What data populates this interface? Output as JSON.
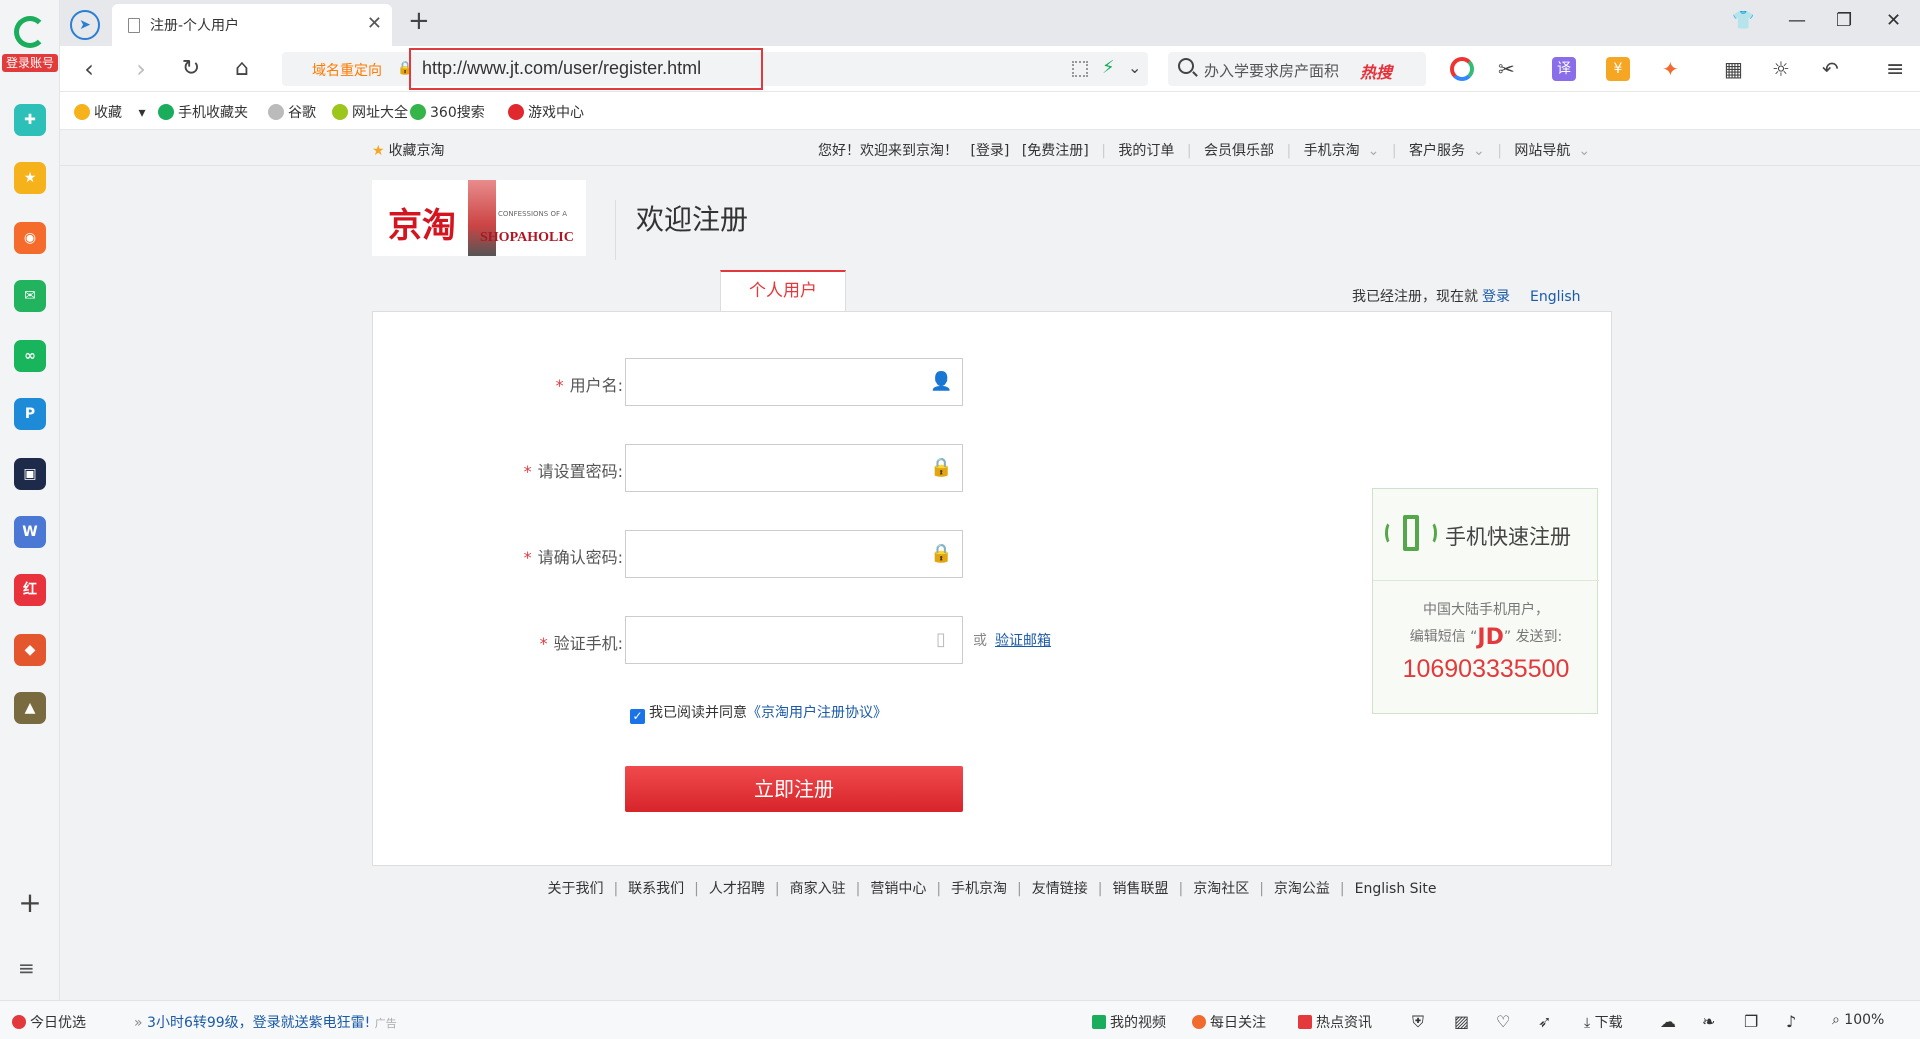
{
  "sidebar": {
    "login_label": "登录账号",
    "apps": [
      {
        "icon": "health-app-icon",
        "color": "#2cc0b8",
        "glyph": "✚"
      },
      {
        "icon": "star-bookmark-app-icon",
        "color": "#f5b21b",
        "glyph": "★"
      },
      {
        "icon": "weibo-app-icon",
        "color": "#f46b2b",
        "glyph": "◉"
      },
      {
        "icon": "mail-app-icon",
        "color": "#22b35e",
        "glyph": "✉"
      },
      {
        "icon": "cloud-app-icon",
        "color": "#19b55c",
        "glyph": "∞"
      },
      {
        "icon": "p-app-icon",
        "color": "#1e8bd9",
        "glyph": "P"
      },
      {
        "icon": "news-app-icon",
        "color": "#1d2a4a",
        "glyph": "▣"
      },
      {
        "icon": "word-doc-app-icon",
        "color": "#4a78d4",
        "glyph": "W"
      },
      {
        "icon": "xiaohongshu-app-icon",
        "color": "#e8323c",
        "glyph": "红"
      },
      {
        "icon": "game-app-icon",
        "color": "#e4572e",
        "glyph": "◆"
      },
      {
        "icon": "pubg-app-icon",
        "color": "#7a6a40",
        "glyph": "▲"
      }
    ]
  },
  "tab": {
    "title": "注册-个人用户"
  },
  "toolbar": {
    "redirect_label": "域名重定向",
    "url": "http://www.jt.com/user/register.html",
    "search_query": "办入学要求房产面积",
    "hot_label": "热搜"
  },
  "bookmarks": [
    {
      "label": "收藏",
      "icon": "star-icon",
      "color": "#f5b21b"
    },
    {
      "label": "手机收藏夹",
      "icon": "phone-icon",
      "color": "#1aad5c"
    },
    {
      "label": "谷歌",
      "icon": "doc-icon",
      "color": "#bbbbbb"
    },
    {
      "label": "网址大全",
      "icon": "nav-icon",
      "color": "#9dc61c"
    },
    {
      "label": "360搜索",
      "icon": "360-icon",
      "color": "#35b44a"
    },
    {
      "label": "游戏中心",
      "icon": "game-center-icon",
      "color": "#e1282f"
    }
  ],
  "topnav": {
    "favorite": "收藏京淘",
    "greeting": "您好！欢迎来到京淘！",
    "login": "[登录]",
    "register": "[免费注册]",
    "items": [
      "我的订单",
      "会员俱乐部",
      "手机京淘",
      "客户服务",
      "网站导航"
    ]
  },
  "header": {
    "logo_text": "京淘",
    "book_title": "SHOPAHOLIC",
    "book_sub": "CONFESSIONS OF A",
    "welcome": "欢迎注册"
  },
  "tabs": {
    "personal": "个人用户",
    "already": "我已经注册，现在就",
    "login": "登录",
    "english": "English"
  },
  "form": {
    "fields": [
      {
        "label": "用户名:",
        "icon": "user-icon"
      },
      {
        "label": "请设置密码:",
        "icon": "lock-icon"
      },
      {
        "label": "请确认密码:",
        "icon": "lock-icon"
      },
      {
        "label": "验证手机:",
        "icon": "phone-icon"
      }
    ],
    "or": "或",
    "verify_email": "验证邮箱",
    "agree_text": "我已阅读并同意",
    "agreement": "《京淘用户注册协议》",
    "submit": "立即注册"
  },
  "mobile_reg": {
    "title": "手机快速注册",
    "line1": "中国大陆手机用户，",
    "line2_pre": "编辑短信 “",
    "code": "JD",
    "line2_post": "” 发送到:",
    "number": "106903335500"
  },
  "footer": [
    "关于我们",
    "联系我们",
    "人才招聘",
    "商家入驻",
    "营销中心",
    "手机京淘",
    "友情链接",
    "销售联盟",
    "京淘社区",
    "京淘公益",
    "English Site"
  ],
  "statusbar": {
    "today": "今日优选",
    "promo": "3小时6转99级，登录就送紫电狂雷!",
    "ad": "广告",
    "video": "我的视频",
    "daily": "每日关注",
    "news": "热点资讯",
    "download": "下载",
    "zoom": "100%"
  }
}
